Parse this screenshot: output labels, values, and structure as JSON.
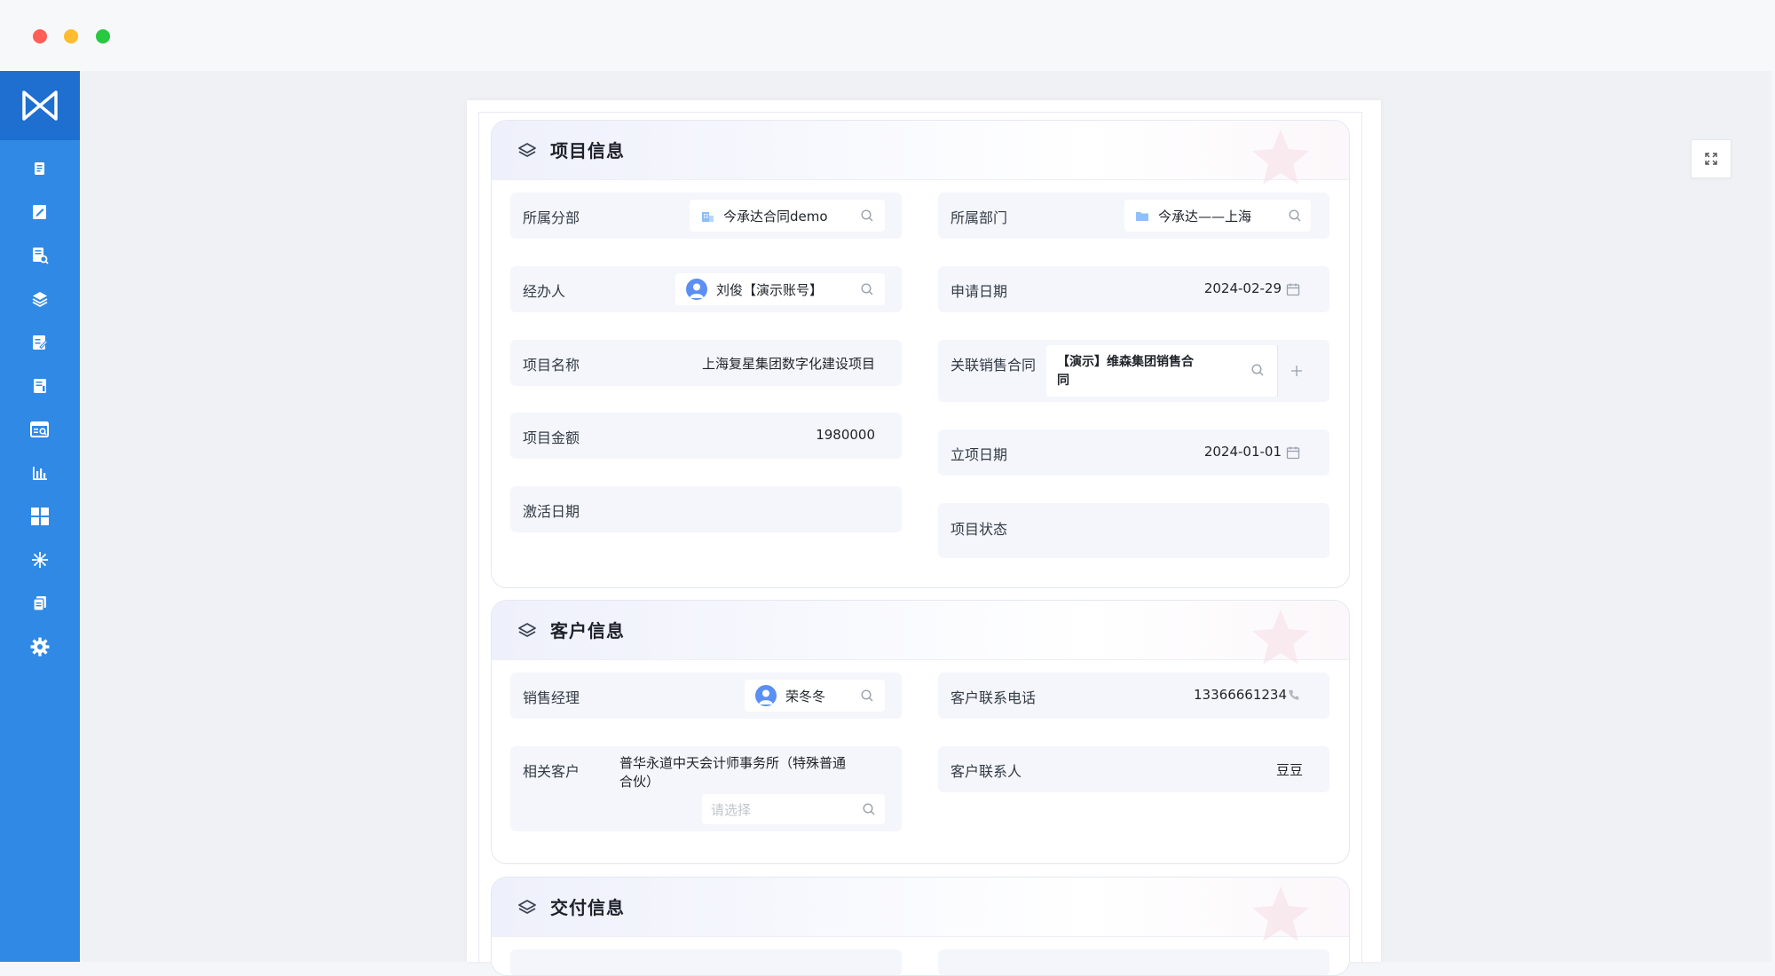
{
  "window": {
    "controls": [
      "close",
      "minimize",
      "maximize"
    ]
  },
  "sidebar": {
    "logo": "app-logo",
    "items": [
      {
        "icon": "document-icon"
      },
      {
        "icon": "edit-icon"
      },
      {
        "icon": "file-search-icon"
      },
      {
        "icon": "layers-icon"
      },
      {
        "icon": "form-edit-icon"
      },
      {
        "icon": "ledger-icon"
      },
      {
        "icon": "report-search-icon"
      },
      {
        "icon": "bar-chart-icon"
      },
      {
        "icon": "grid-icon"
      },
      {
        "icon": "network-icon"
      },
      {
        "icon": "copy-icon"
      },
      {
        "icon": "settings-icon"
      }
    ]
  },
  "project": {
    "title": "项目信息",
    "branch_label": "所属分部",
    "branch_value": "今承达合同demo",
    "dept_label": "所属部门",
    "dept_value": "今承达——上海",
    "handler_label": "经办人",
    "handler_value": "刘俊【演示账号】",
    "apply_date_label": "申请日期",
    "apply_date_value": "2024-02-29",
    "name_label": "项目名称",
    "name_value": "上海复星集团数字化建设项目",
    "contract_label": "关联销售合同",
    "contract_value_line1": "【演示】维森集团销售合",
    "contract_value_line2": "同",
    "amount_label": "项目金额",
    "amount_value": "1980000",
    "setup_date_label": "立项日期",
    "setup_date_value": "2024-01-01",
    "activate_label": "激活日期",
    "status_label": "项目状态"
  },
  "customer": {
    "title": "客户信息",
    "manager_label": "销售经理",
    "manager_value": "荣冬冬",
    "phone_label": "客户联系电话",
    "phone_value": "13366661234",
    "related_label": "相关客户",
    "related_value_line1": "普华永道中天会计师事务所（特殊普通",
    "related_value_line2": "合伙）",
    "related_placeholder": "请选择",
    "contact_label": "客户联系人",
    "contact_value": "豆豆"
  },
  "delivery": {
    "title": "交付信息"
  }
}
